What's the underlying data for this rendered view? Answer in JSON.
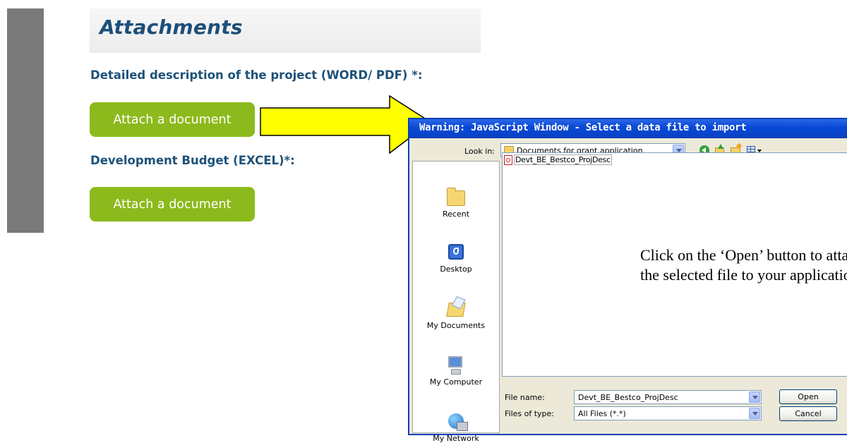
{
  "page": {
    "section_title": "Attachments",
    "fields": [
      {
        "label": "Detailed description of the project (WORD/ PDF) *:",
        "button": "Attach a document"
      },
      {
        "label": "Development Budget (EXCEL)*:",
        "button": "Attach a document"
      }
    ]
  },
  "dialog": {
    "title": "Warning: JavaScript Window - Select a data file to import",
    "look_in_label": "Look in:",
    "look_in_value": "Documents for grant application",
    "places": [
      "Recent",
      "Desktop",
      "My Documents",
      "My Computer",
      "My Network"
    ],
    "files": [
      "Devt_BE_Bestco_ProjDesc"
    ],
    "file_name_label": "File name:",
    "file_name_value": "Devt_BE_Bestco_ProjDesc",
    "file_type_label": "Files of type:",
    "file_type_value": "All Files (*.*)",
    "open_label": "Open",
    "cancel_label": "Cancel"
  },
  "annotation": "Click on the ‘Open’ button to attach the selected file to your application.",
  "colors": {
    "title_blue": "#1c4f7a",
    "button_green": "#8cba1c",
    "arrow_yellow": "#ffff00",
    "dialog_title_blue": "#0a49d6"
  },
  "icons": {
    "toolbar": [
      "back-icon",
      "up-folder-icon",
      "new-folder-icon",
      "views-menu-icon"
    ],
    "places": [
      "recent-icon",
      "desktop-icon",
      "my-documents-icon",
      "my-computer-icon",
      "my-network-icon"
    ],
    "file": "pdf-file-icon",
    "pointer": "yellow-arrow-pointer"
  }
}
